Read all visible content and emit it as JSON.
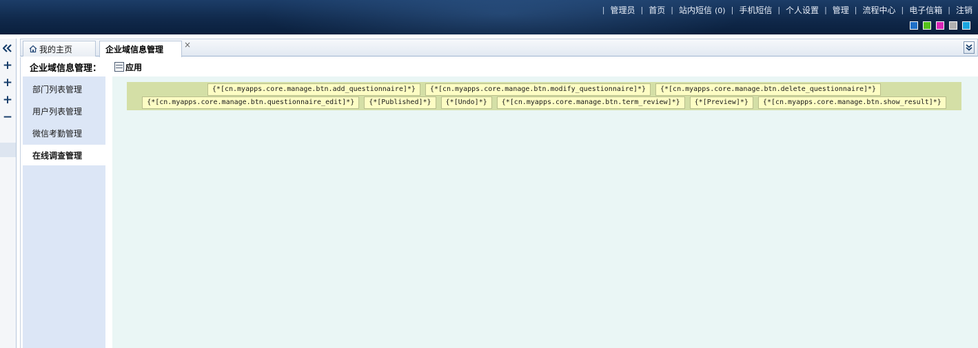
{
  "header": {
    "nav": [
      {
        "key": "admin",
        "label": "管理员"
      },
      {
        "key": "home",
        "label": "首页"
      },
      {
        "key": "inbox",
        "label": "站内短信",
        "count": "(0)"
      },
      {
        "key": "sms",
        "label": "手机短信"
      },
      {
        "key": "settings",
        "label": "个人设置"
      },
      {
        "key": "manage",
        "label": "管理"
      },
      {
        "key": "workflow",
        "label": "流程中心"
      },
      {
        "key": "email",
        "label": "电子信箱"
      },
      {
        "key": "logout",
        "label": "注销"
      }
    ],
    "separator": "|",
    "theme_colors": [
      "#1e6fc8",
      "#55c21c",
      "#d928b8",
      "#b0b0b0",
      "#1aa6e0"
    ]
  },
  "left_rail": {
    "collapse_icon": "double-chevron-left-icon",
    "buttons": [
      "+",
      "+",
      "+",
      "−"
    ]
  },
  "tabs": [
    {
      "label": "我的主页",
      "icon": "home-icon"
    },
    {
      "label": "企业域信息管理",
      "close": "×",
      "active": true
    }
  ],
  "sidebar": {
    "title": "企业域信息管理：",
    "items": [
      {
        "label": "部门列表管理"
      },
      {
        "label": "用户列表管理"
      },
      {
        "label": "微信考勤管理"
      },
      {
        "label": "在线调查管理",
        "active": true
      }
    ]
  },
  "main": {
    "apply_label": "应用",
    "toolbar_row1": [
      "{*[cn.myapps.core.manage.btn.add_questionnaire]*}",
      "{*[cn.myapps.core.manage.btn.modify_questionnaire]*}",
      "{*[cn.myapps.core.manage.btn.delete_questionnaire]*}"
    ],
    "toolbar_row2": [
      "{*[cn.myapps.core.manage.btn.questionnaire_edit]*}",
      "{*[Published]*}",
      "{*[Undo]*}",
      "{*[cn.myapps.core.manage.btn.term_review]*}",
      "{*[Preview]*}",
      "{*[cn.myapps.core.manage.btn.show_result]*}"
    ]
  }
}
